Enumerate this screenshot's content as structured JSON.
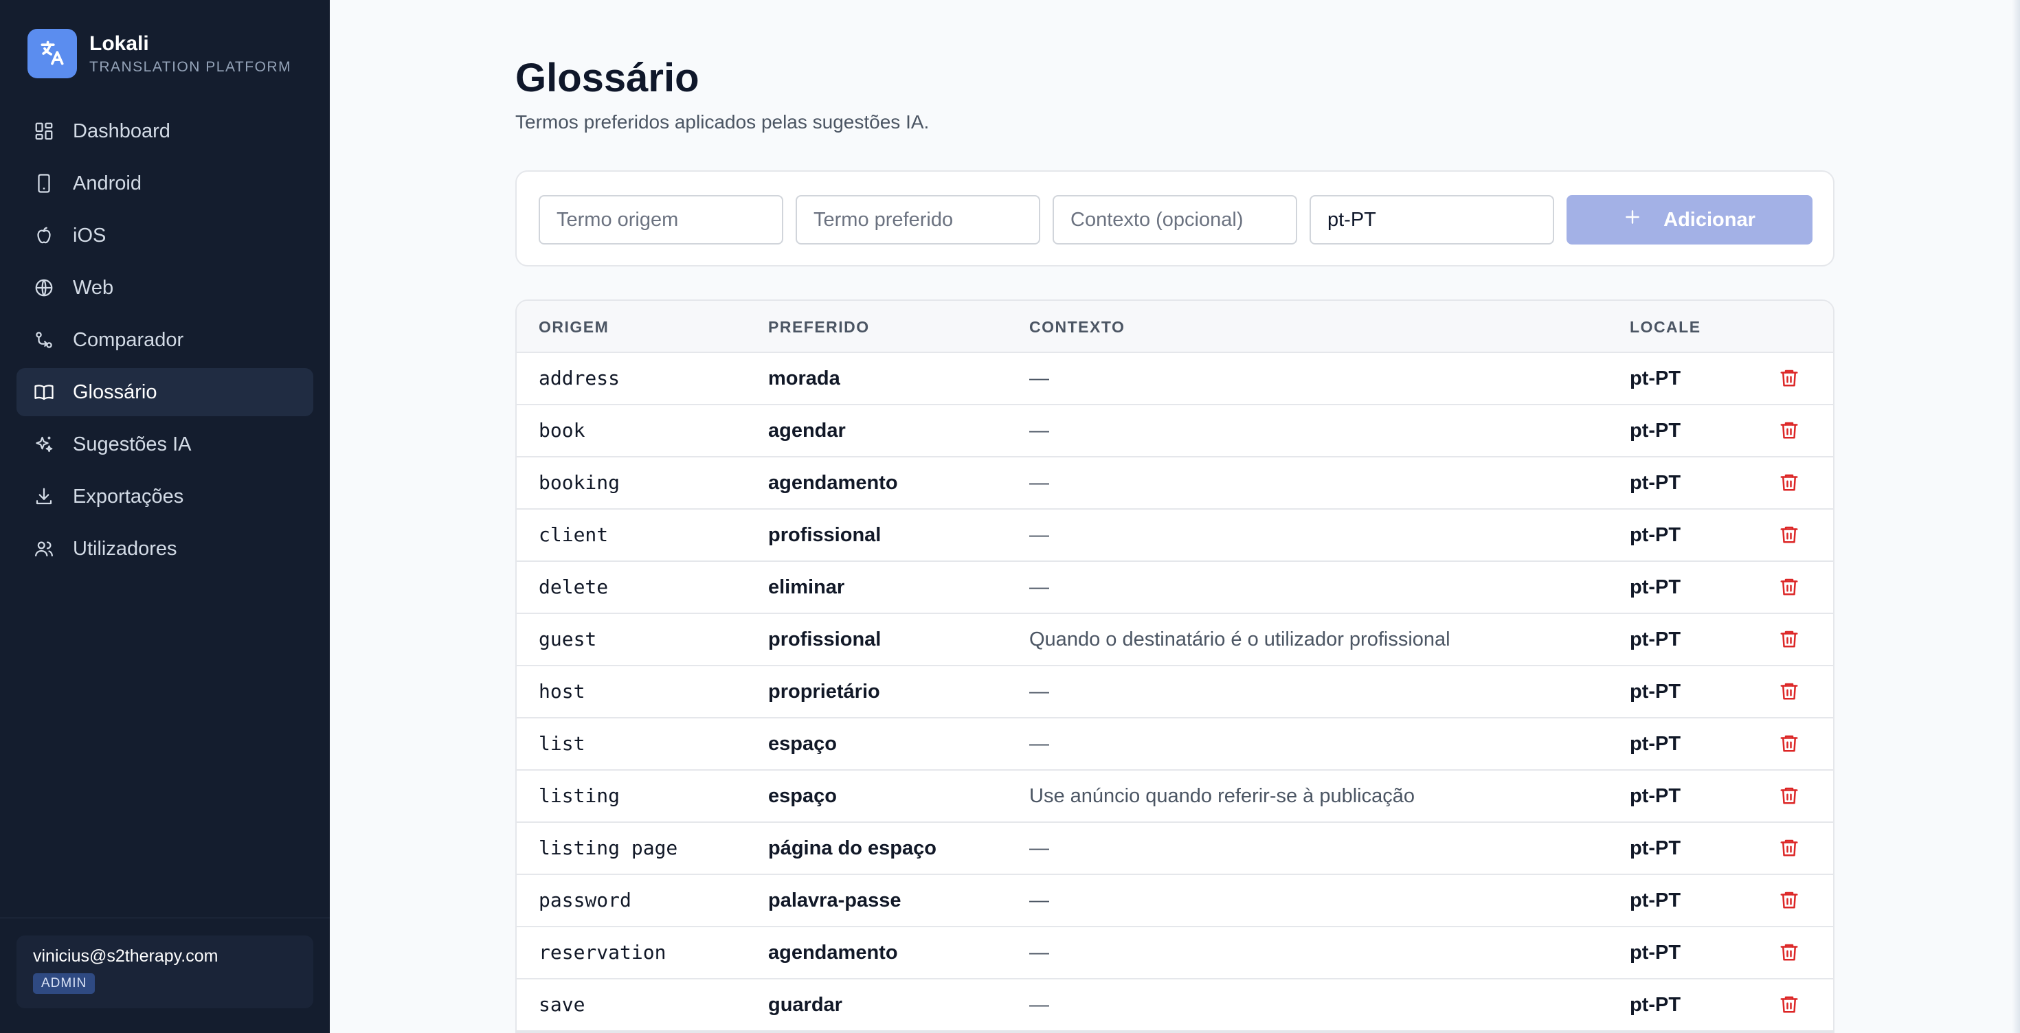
{
  "brand": {
    "name": "Lokali",
    "subtitle": "TRANSLATION PLATFORM"
  },
  "sidebar": {
    "items": [
      {
        "label": "Dashboard",
        "icon": "dashboard-icon",
        "active": false
      },
      {
        "label": "Android",
        "icon": "phone-icon",
        "active": false
      },
      {
        "label": "iOS",
        "icon": "apple-icon",
        "active": false
      },
      {
        "label": "Web",
        "icon": "globe-icon",
        "active": false
      },
      {
        "label": "Comparador",
        "icon": "compare-icon",
        "active": false
      },
      {
        "label": "Glossário",
        "icon": "book-icon",
        "active": true
      },
      {
        "label": "Sugestões IA",
        "icon": "sparkles-icon",
        "active": false
      },
      {
        "label": "Exportações",
        "icon": "download-icon",
        "active": false
      },
      {
        "label": "Utilizadores",
        "icon": "users-icon",
        "active": false
      }
    ]
  },
  "user": {
    "email": "vinicius@s2therapy.com",
    "role": "ADMIN"
  },
  "page": {
    "title": "Glossário",
    "subtitle": "Termos preferidos aplicados pelas sugestões IA."
  },
  "form": {
    "source_placeholder": "Termo origem",
    "preferred_placeholder": "Termo preferido",
    "context_placeholder": "Contexto (opcional)",
    "locale_value": "pt-PT",
    "add_label": "Adicionar"
  },
  "table": {
    "headers": {
      "source": "ORIGEM",
      "preferred": "PREFERIDO",
      "context": "CONTEXTO",
      "locale": "LOCALE"
    },
    "rows": [
      {
        "source": "address",
        "preferred": "morada",
        "context": "—",
        "locale": "pt-PT"
      },
      {
        "source": "book",
        "preferred": "agendar",
        "context": "—",
        "locale": "pt-PT"
      },
      {
        "source": "booking",
        "preferred": "agendamento",
        "context": "—",
        "locale": "pt-PT"
      },
      {
        "source": "client",
        "preferred": "profissional",
        "context": "—",
        "locale": "pt-PT"
      },
      {
        "source": "delete",
        "preferred": "eliminar",
        "context": "—",
        "locale": "pt-PT"
      },
      {
        "source": "guest",
        "preferred": "profissional",
        "context": "Quando o destinatário é o utilizador profissional",
        "locale": "pt-PT"
      },
      {
        "source": "host",
        "preferred": "proprietário",
        "context": "—",
        "locale": "pt-PT"
      },
      {
        "source": "list",
        "preferred": "espaço",
        "context": "—",
        "locale": "pt-PT"
      },
      {
        "source": "listing",
        "preferred": "espaço",
        "context": "Use anúncio quando referir-se à publicação",
        "locale": "pt-PT"
      },
      {
        "source": "listing page",
        "preferred": "página do espaço",
        "context": "—",
        "locale": "pt-PT"
      },
      {
        "source": "password",
        "preferred": "palavra-passe",
        "context": "—",
        "locale": "pt-PT"
      },
      {
        "source": "reservation",
        "preferred": "agendamento",
        "context": "—",
        "locale": "pt-PT"
      },
      {
        "source": "save",
        "preferred": "guardar",
        "context": "—",
        "locale": "pt-PT"
      }
    ]
  },
  "colors": {
    "sidebar_bg": "#141d2e",
    "brand_accent": "#5b8def",
    "add_button": "#a3b1e6",
    "delete_icon": "#dc2626"
  }
}
